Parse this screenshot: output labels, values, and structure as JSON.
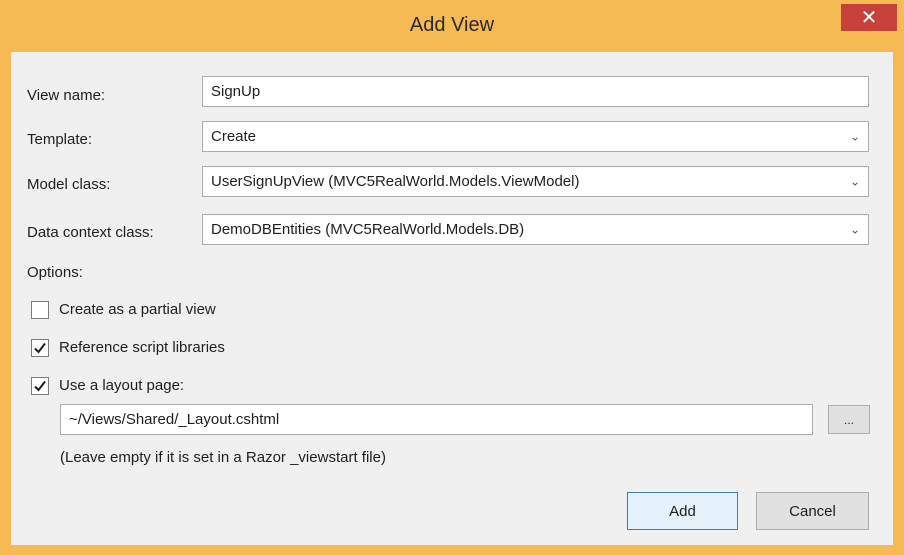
{
  "window": {
    "title": "Add View",
    "close_label": "✕"
  },
  "fields": {
    "view_name": {
      "label": "View name:",
      "value": "SignUp"
    },
    "template": {
      "label": "Template:",
      "value": "Create"
    },
    "model_class": {
      "label": "Model class:",
      "value": "UserSignUpView (MVC5RealWorld.Models.ViewModel)"
    },
    "data_context": {
      "label": "Data context class:",
      "value": "DemoDBEntities (MVC5RealWorld.Models.DB)"
    }
  },
  "options": {
    "heading": "Options:",
    "partial_view": {
      "label": "Create as a partial view",
      "checked": false
    },
    "reference_scripts": {
      "label": "Reference script libraries",
      "checked": true
    },
    "layout_page": {
      "label": "Use a layout page:",
      "checked": true
    },
    "layout_path": "~/Views/Shared/_Layout.cshtml",
    "browse_label": "...",
    "hint": "(Leave empty if it is set in a Razor _viewstart file)"
  },
  "buttons": {
    "add": "Add",
    "cancel": "Cancel"
  },
  "colors": {
    "frame": "#f6ba55",
    "close": "#c7413a",
    "client": "#f0f0f0",
    "default_button_border": "#3c7fb1"
  },
  "icons": {
    "dropdown": "chevron-down-icon",
    "check": "checkmark-icon",
    "close": "close-icon"
  }
}
